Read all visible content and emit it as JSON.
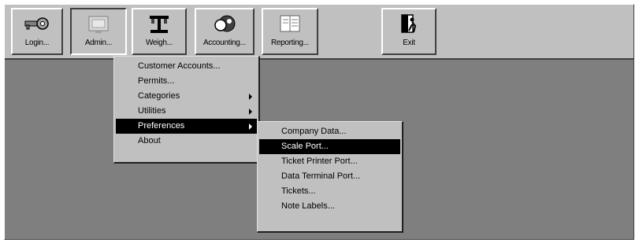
{
  "toolbar": {
    "buttons": [
      {
        "label": "Login...",
        "icon": "key-icon"
      },
      {
        "label": "Admin...",
        "icon": "admin-icon"
      },
      {
        "label": "Weigh...",
        "icon": "scale-icon"
      },
      {
        "label": "Accounting...",
        "icon": "accounting-icon"
      },
      {
        "label": "Reporting...",
        "icon": "reporting-icon"
      },
      {
        "label": "Exit",
        "icon": "exit-door-icon"
      }
    ]
  },
  "admin_menu": {
    "items": [
      {
        "label": "Customer Accounts...",
        "has_submenu": false
      },
      {
        "label": "Permits...",
        "has_submenu": false
      },
      {
        "label": "Categories",
        "has_submenu": true
      },
      {
        "label": "Utilities",
        "has_submenu": true
      },
      {
        "label": "Preferences",
        "has_submenu": true,
        "highlighted": true
      },
      {
        "label": "About",
        "has_submenu": false
      }
    ]
  },
  "preferences_submenu": {
    "items": [
      {
        "label": "Company Data...",
        "highlighted": false
      },
      {
        "label": "Scale Port...",
        "highlighted": true
      },
      {
        "label": "Ticket Printer Port...",
        "highlighted": false
      },
      {
        "label": "Data Terminal Port...",
        "highlighted": false
      },
      {
        "label": "Tickets...",
        "highlighted": false
      },
      {
        "label": "Note Labels...",
        "highlighted": false
      }
    ]
  },
  "colors": {
    "chrome": "#c0c0c0",
    "workspace": "#7f7f7f",
    "highlight": "#000000",
    "highlight_text": "#ffffff"
  }
}
